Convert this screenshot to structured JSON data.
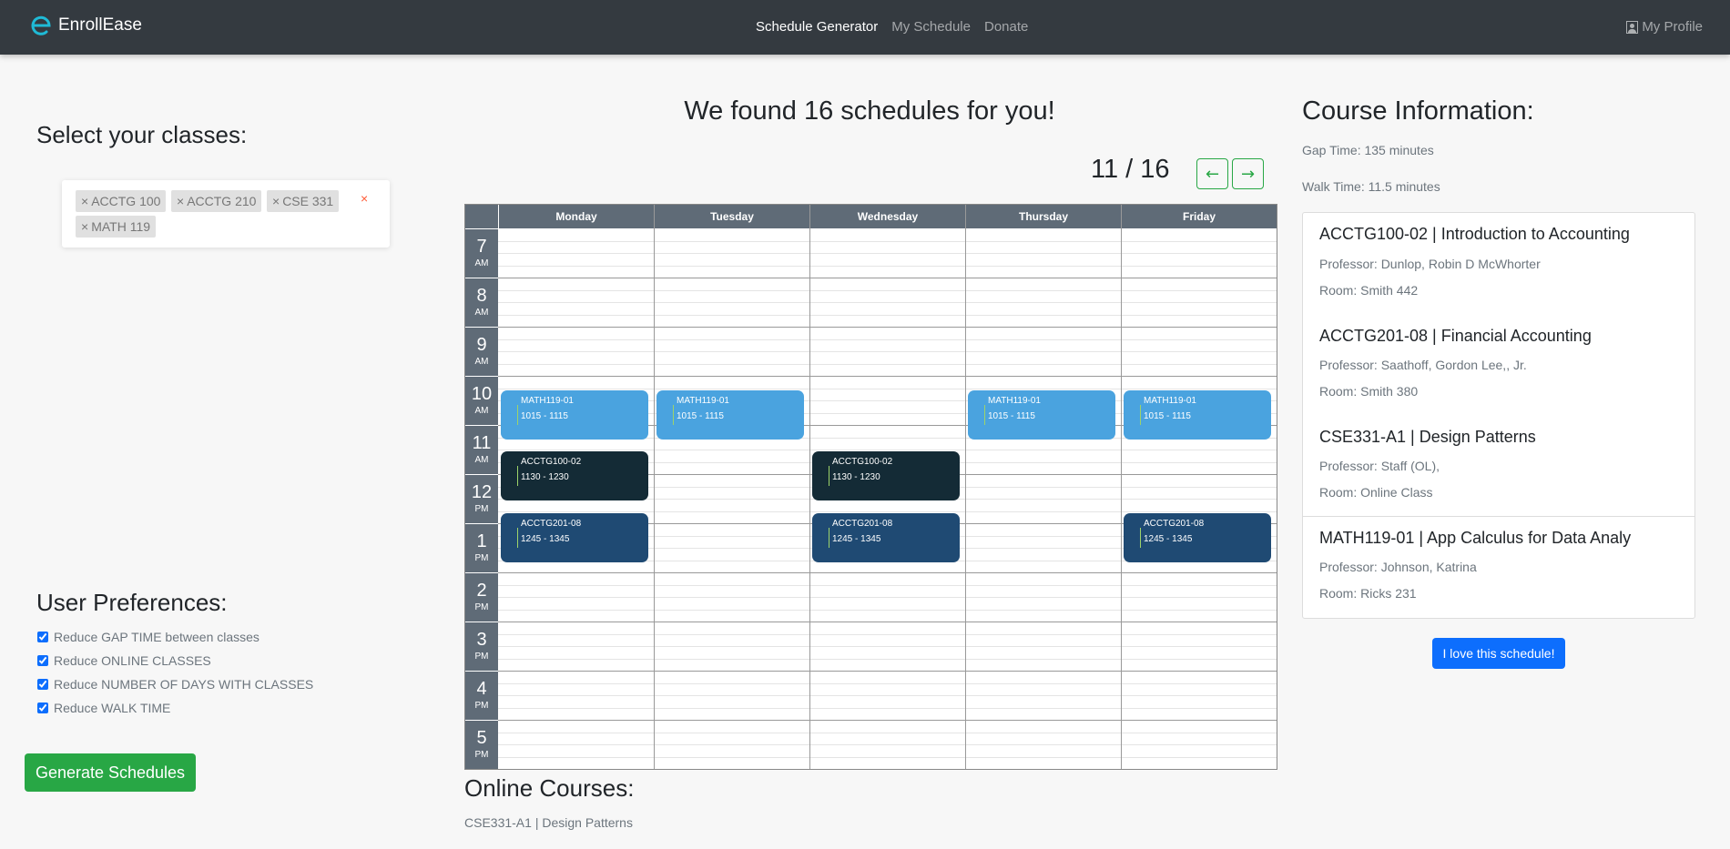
{
  "nav": {
    "brand": "EnrollEase",
    "links": [
      "Schedule Generator",
      "My Schedule",
      "Donate"
    ],
    "profile": "My Profile"
  },
  "classes": {
    "title": "Select your classes:",
    "tags": [
      "ACCTG 100",
      "ACCTG 210",
      "CSE 331",
      "MATH 119"
    ],
    "tag_remove": "×",
    "clear": "×"
  },
  "preferences": {
    "title": "User Preferences:",
    "items": [
      {
        "label": "Reduce GAP TIME between classes",
        "checked": true
      },
      {
        "label": "Reduce ONLINE CLASSES",
        "checked": true
      },
      {
        "label": "Reduce NUMBER OF DAYS WITH CLASSES",
        "checked": true
      },
      {
        "label": "Reduce WALK TIME",
        "checked": true
      }
    ],
    "generate_button": "Generate Schedules"
  },
  "results": {
    "title": "We found 16 schedules for you!",
    "counter": "11 / 16",
    "prev_icon": "←",
    "next_icon": "→"
  },
  "calendar": {
    "days": [
      "Monday",
      "Tuesday",
      "Wednesday",
      "Thursday",
      "Friday"
    ],
    "hours": [
      {
        "num": "7",
        "ampm": "AM"
      },
      {
        "num": "8",
        "ampm": "AM"
      },
      {
        "num": "9",
        "ampm": "AM"
      },
      {
        "num": "10",
        "ampm": "AM"
      },
      {
        "num": "11",
        "ampm": "AM"
      },
      {
        "num": "12",
        "ampm": "PM"
      },
      {
        "num": "1",
        "ampm": "PM"
      },
      {
        "num": "2",
        "ampm": "PM"
      },
      {
        "num": "3",
        "ampm": "PM"
      },
      {
        "num": "4",
        "ampm": "PM"
      },
      {
        "num": "5",
        "ampm": "PM"
      }
    ],
    "events": [
      {
        "code": "MATH119-01",
        "time": "1015 - 1115",
        "day": 0,
        "start_hour": 10.25,
        "color": "#4aa3df"
      },
      {
        "code": "MATH119-01",
        "time": "1015 - 1115",
        "day": 1,
        "start_hour": 10.25,
        "color": "#4aa3df"
      },
      {
        "code": "MATH119-01",
        "time": "1015 - 1115",
        "day": 3,
        "start_hour": 10.25,
        "color": "#4aa3df"
      },
      {
        "code": "MATH119-01",
        "time": "1015 - 1115",
        "day": 4,
        "start_hour": 10.25,
        "color": "#4aa3df"
      },
      {
        "code": "ACCTG100-02",
        "time": "1130 - 1230",
        "day": 0,
        "start_hour": 11.5,
        "color": "#142b36"
      },
      {
        "code": "ACCTG100-02",
        "time": "1130 - 1230",
        "day": 2,
        "start_hour": 11.5,
        "color": "#142b36"
      },
      {
        "code": "ACCTG201-08",
        "time": "1245 - 1345",
        "day": 0,
        "start_hour": 12.75,
        "color": "#1f4a73"
      },
      {
        "code": "ACCTG201-08",
        "time": "1245 - 1345",
        "day": 2,
        "start_hour": 12.75,
        "color": "#1f4a73"
      },
      {
        "code": "ACCTG201-08",
        "time": "1245 - 1345",
        "day": 4,
        "start_hour": 12.75,
        "color": "#1f4a73"
      }
    ]
  },
  "online": {
    "title": "Online Courses:",
    "items": [
      "CSE331-A1 | Design Patterns"
    ]
  },
  "info": {
    "title": "Course Information:",
    "gap_time": "Gap Time: 135 minutes",
    "walk_time": "Walk Time: 11.5 minutes",
    "courses": [
      {
        "title": "ACCTG100-02 | Introduction to Accounting",
        "professor": "Professor: Dunlop, Robin D McWhorter",
        "room": "Room: Smith 442"
      },
      {
        "title": "ACCTG201-08 | Financial Accounting",
        "professor": "Professor: Saathoff, Gordon Lee,, Jr.",
        "room": "Room: Smith 380"
      },
      {
        "title": "CSE331-A1 | Design Patterns",
        "professor": "Professor: Staff (OL),",
        "room": "Room: Online Class"
      },
      {
        "title": "MATH119-01 | App Calculus for Data Analy",
        "professor": "Professor: Johnson, Katrina",
        "room": "Room: Ricks 231"
      }
    ],
    "love_button": "I love this schedule!"
  }
}
